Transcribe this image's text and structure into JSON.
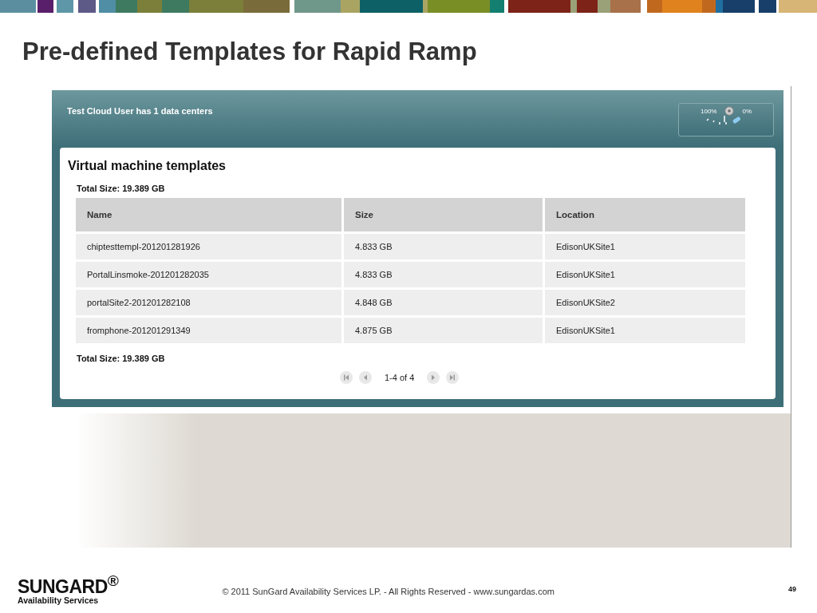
{
  "slide_title": "Pre-defined Templates for Rapid Ramp",
  "app": {
    "header_text": "Test Cloud User has 1 data centers",
    "gauge": {
      "left_label": "100%",
      "right_label": "0%"
    },
    "panel": {
      "title": "Virtual machine templates",
      "total_top": "Total Size:  19.389 GB",
      "total_bottom": "Total Size:  19.389 GB",
      "table": {
        "columns": [
          "Name",
          "Size",
          "Location"
        ],
        "rows": [
          [
            "chiptesttempl-201201281926",
            "4.833 GB",
            "EdisonUKSite1"
          ],
          [
            "PortalLinsmoke-201201282035",
            "4.833 GB",
            "EdisonUKSite1"
          ],
          [
            "portalSite2-201201282108",
            "4.848 GB",
            "EdisonUKSite2"
          ],
          [
            "fromphone-201201291349",
            "4.875 GB",
            "EdisonUKSite1"
          ]
        ]
      },
      "pager": {
        "text": "1-4 of 4"
      }
    }
  },
  "footer": {
    "logo_name": "SUNGARD$^{®}$",
    "logo_sub": "Availability Services",
    "copyright": "© 2011 SunGard Availability Services LP. - All Rights Reserved - www.sungardas.com",
    "page_number": "49"
  }
}
